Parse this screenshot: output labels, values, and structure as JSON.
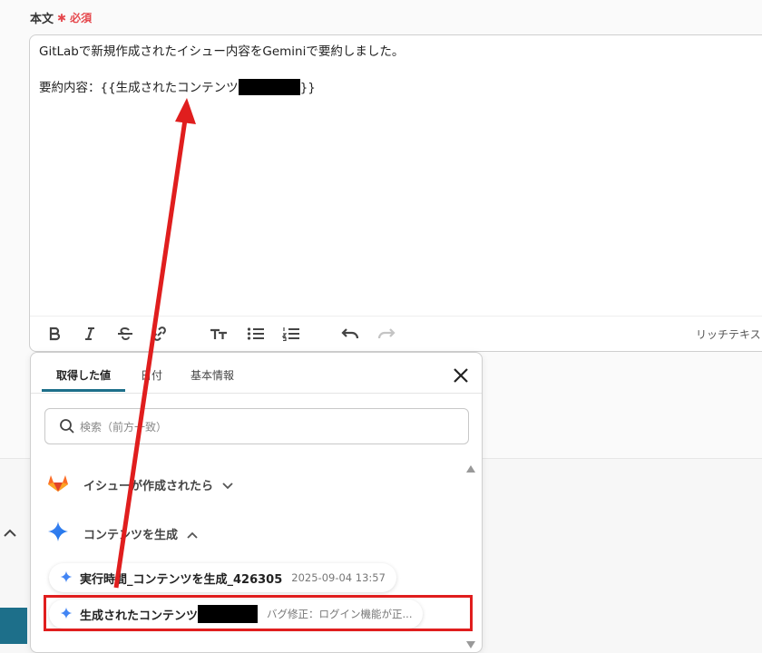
{
  "field": {
    "label": "本文",
    "required_mark": "✱",
    "required_text": "必須"
  },
  "editor": {
    "line1": "GitLabで新規作成されたイシュー内容をGeminiで要約しました。",
    "line2_prefix": "要約内容：{{生成されたコンテンツ",
    "line2_suffix": "}}",
    "rich_text_label": "リッチテキス"
  },
  "popup": {
    "tabs": [
      "取得した値",
      "日付",
      "基本情報"
    ],
    "search_placeholder": "検索（前方一致）",
    "groups": [
      {
        "label": "イシューが作成されたら",
        "icon": "gitlab-icon",
        "chevron": "down"
      },
      {
        "label": "コンテンツを生成",
        "icon": "gemini-icon",
        "chevron": "up"
      }
    ],
    "items": [
      {
        "label": "実行時間_コンテンツを生成_426305",
        "value": "2025-09-04 13:57",
        "icon": "gemini-icon"
      },
      {
        "label": "生成されたコンテンツ",
        "value": "バグ修正：ログイン機能が正...",
        "icon": "gemini-icon"
      }
    ]
  },
  "colors": {
    "accent": "#1d6f8a",
    "annotation": "#e01e1e",
    "required": "#e5484d"
  }
}
